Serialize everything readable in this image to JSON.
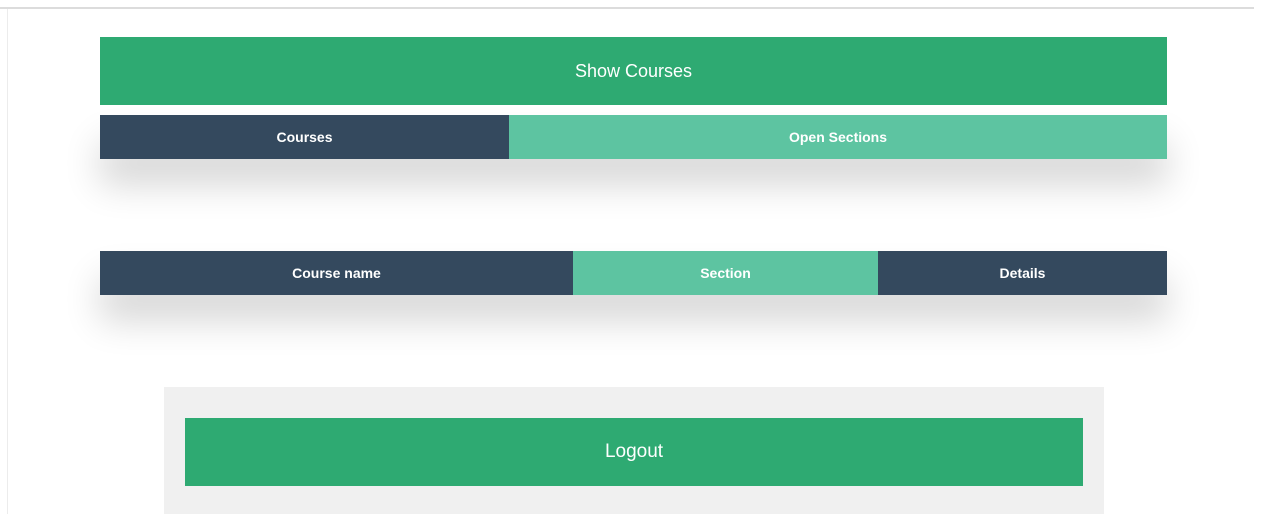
{
  "actions": {
    "show_courses_label": "Show Courses",
    "logout_label": "Logout"
  },
  "tabs": [
    {
      "label": "Courses"
    },
    {
      "label": "Open Sections"
    }
  ],
  "table": {
    "columns": [
      "Course name",
      "Section",
      "Details"
    ]
  },
  "colors": {
    "primary_green": "#2eaa72",
    "light_green": "#5dc4a1",
    "dark_slate": "#34495e",
    "panel_gray": "#f0f0f0"
  }
}
